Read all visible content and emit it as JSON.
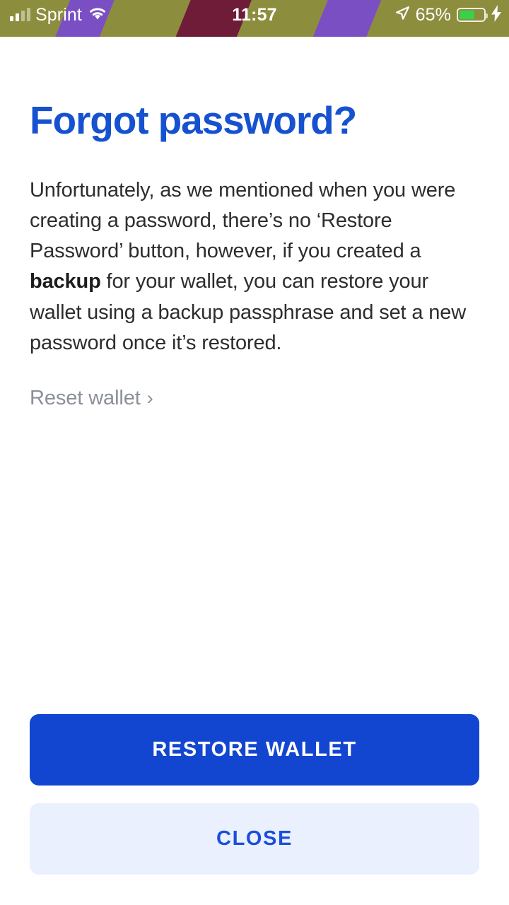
{
  "status_bar": {
    "carrier": "Sprint",
    "time": "11:57",
    "battery_percent": "65%",
    "battery_level": 65,
    "signal_bars_filled": 2,
    "signal_bars_total": 4,
    "icons": [
      "signal-bars-icon",
      "wifi-icon",
      "location-arrow-icon",
      "battery-icon",
      "charging-bolt-icon"
    ],
    "colors": {
      "text": "#ffffff",
      "battery_fill": "#38d14a"
    }
  },
  "screen": {
    "title": "Forgot password?",
    "body": {
      "part1": "Unfortunately, as we mentioned when you were creating a password, there’s no ‘Restore Password’ button, however, if you created a ",
      "emphasis": "backup",
      "part2": " for your wallet, you can restore your wallet using a backup passphrase and set a new password once it’s restored."
    },
    "reset_link": {
      "label": "Reset wallet",
      "chevron": "›"
    }
  },
  "buttons": {
    "primary": "RESTORE WALLET",
    "secondary": "CLOSE"
  },
  "colors": {
    "accent_blue": "#1346d0",
    "title_blue": "#1652d0",
    "secondary_button_bg": "#eaf0fd",
    "secondary_button_text": "#1a4ede",
    "body_text": "#2d2d2d",
    "muted_text": "#8b8f99",
    "card_bg": "#ffffff"
  }
}
